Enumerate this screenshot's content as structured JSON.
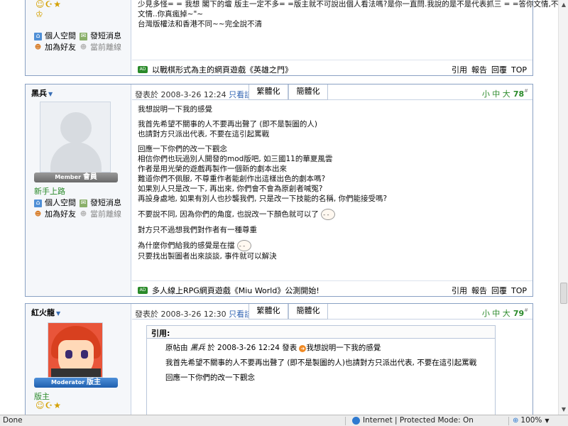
{
  "post_top": {
    "text_lines": [
      "少見多怪= = 我想 閣下的壇 版主一定不多= =版主就不可說出個人看法嗎?是你一直問.我說的是不是代表抓三 = =答你文情,不答",
      "文情..你真瘋掉~\"~",
      "台灣版權法和香港不同~~完全說不清"
    ],
    "user_links": {
      "space": "個人空間",
      "message": "發短消息",
      "add_friend": "加為好友",
      "online": "當前離線"
    },
    "ad_text": "以戰棋形式為主的網頁遊戲《英雄之門》",
    "actions": [
      "引用",
      "報告",
      "回覆",
      "TOP"
    ]
  },
  "post_1": {
    "author": "黑兵",
    "rank_label": "Member",
    "rank_big": "會員",
    "user_title": "新手上路",
    "posted_label": "發表於 2008-3-26 12:24",
    "only_author": "只看該作者",
    "tab_traditional": "繁體化",
    "tab_simplified": "簡體化",
    "font_sizes": "小 中 大",
    "floor_num": "78",
    "floor_sup": "#",
    "user_links": {
      "space": "個人空間",
      "message": "發短消息",
      "add_friend": "加為好友",
      "online": "當前離線"
    },
    "lines": [
      "我想說明一下我的感覺",
      "我首先希望不關事的人不要再出聲了 (即不是製圖的人)",
      "也請對方只派出代表, 不要在這引起罵戰",
      "回應一下你們的改一下觀念",
      "相信你們也玩過別人開發的mod版吧, 如三國11的華夏風雲",
      "作者是用光榮的遊戲再製作一個新的劇本出來",
      "難道你們不佩服, 不尊重作者能創作出這樣出色的劇本嗎?",
      "如果別人只是改一下, 再出來, 你們會不會為原創者喊冤?",
      "再設身處地, 如果有別人也抄襲我們, 只是改一下技能的名稱, 你們能接受嗎?",
      "不要說不同, 因為你們的角度, 也說改一下顏色就可以了",
      "對方只不過想我們對作者有一種尊重",
      "為什麼你們給我的感覺是在擋",
      "只要找出製圖者出來談談, 事件就可以解決"
    ],
    "ad_text": "多人線上RPG網頁遊戲《Miu World》公測開始!",
    "actions": [
      "引用",
      "報告",
      "回覆",
      "TOP"
    ]
  },
  "post_2": {
    "author": "紅火龍",
    "rank_label": "Moderator",
    "rank_big": "版主",
    "user_title": "版主",
    "posted_label": "發表於 2008-3-26 12:30",
    "only_author": "只看該作者",
    "tab_traditional": "繁體化",
    "tab_simplified": "簡體化",
    "font_sizes": "小 中 大",
    "floor_num": "79",
    "floor_sup": "#",
    "quote": {
      "header": "引用:",
      "source_prefix": "原帖由",
      "source_author": "黑兵",
      "source_suffix": "於 2008-3-26 12:24 發表",
      "lines": [
        "我想說明一下我的感覺",
        "我首先希望不關事的人不要再出聲了 (即不是製圖的人)",
        "也請對方只派出代表, 不要在這引起罵戰",
        "回應一下你們的改一下觀念"
      ]
    }
  },
  "statusbar": {
    "left": "Done",
    "zone": "Internet | Protected Mode: On",
    "zoom": "100%"
  },
  "icons": [
    "home-icon",
    "message-icon",
    "add-friend-icon",
    "offline-icon",
    "ad-icon",
    "quote-source-arrow-icon",
    "globe-icon",
    "zoom-icon",
    "smiley-icon"
  ]
}
